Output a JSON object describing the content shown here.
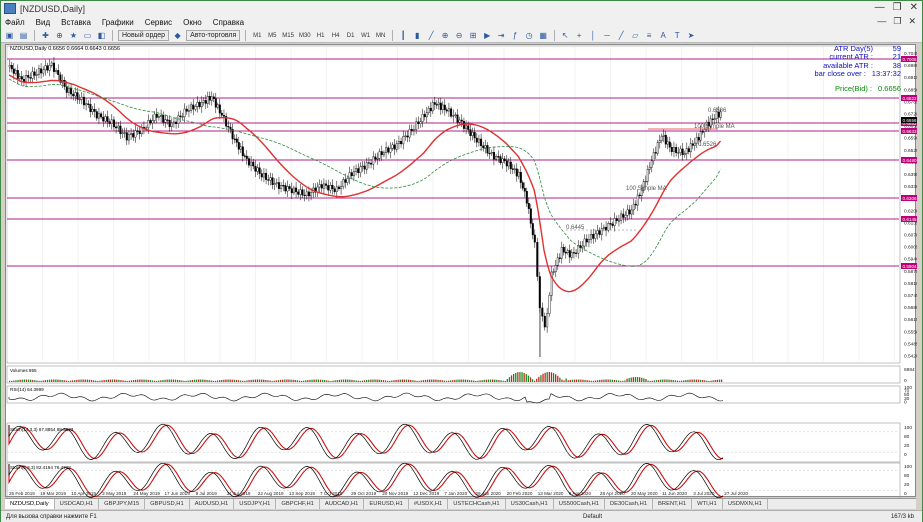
{
  "window": {
    "title": "[NZDUSD,Daily]",
    "controls": [
      "—",
      "❐",
      "✕"
    ]
  },
  "menu": {
    "items": [
      "Файл",
      "Вид",
      "Вставка",
      "Графики",
      "Сервис",
      "Окно",
      "Справка"
    ],
    "mdi_controls": [
      "—",
      "❐",
      "✕"
    ]
  },
  "toolbar": {
    "new_order_label": "Новый ордер",
    "autotrade_label": "Авто-торговля",
    "timeframes": [
      "M1",
      "M5",
      "M15",
      "M30",
      "H1",
      "H4",
      "D1",
      "W1",
      "MN"
    ]
  },
  "chart": {
    "symbol_line": "NZDUSD,Daily  0.6656 0.6664 0.6643 0.6656",
    "volume_label": "Volumes 955",
    "rsi_label": "RSI(14) 64.3999",
    "stoch1_label": "Stoch(14,3,3) 67.8854 68.9833",
    "stoch2_label": "Stoch(5,3,3) 82.4194 76.4738",
    "info": {
      "atr_day_label": "ATR Day(5)",
      "atr_day_value": "59",
      "current_atr_label": "current ATR :",
      "current_atr_value": "21",
      "available_atr_label": "available ATR :",
      "available_atr_value": "38",
      "bar_close_label": "bar close over :",
      "bar_close_value": "13:37:32",
      "price_bid_label": "Price(Bid) :",
      "price_bid_value": "0.6656"
    },
    "annotations": {
      "ma200": "100 Simple MA",
      "ma100": "100 Simple MA",
      "lvl1": "0.6686",
      "lvl2": "0.6526",
      "lvl3": "0.6445"
    },
    "colors": {
      "candle": "#000000",
      "ma_red": "#e03030",
      "ma_green": "#2e8b3e",
      "level_line": "#b0208a",
      "level_tag": "#c0007a",
      "bid_tag": "#000000",
      "stoch_main": "#000000",
      "stoch_signal": "#cc1111",
      "volume_bar": "#cc2222",
      "volume_bar_up": "#1a8a1a"
    },
    "price_labels": [
      "0.7045",
      "0.6980",
      "0.6915",
      "0.6850",
      "0.6785",
      "0.6720",
      "0.6655",
      "0.6590",
      "0.6525",
      "0.6460",
      "0.6395",
      "0.6330",
      "0.6265",
      "0.6200",
      "0.6135",
      "0.6070",
      "0.6005",
      "0.5940",
      "0.5875",
      "0.5810",
      "0.5745",
      "0.5680",
      "0.5615",
      "0.5550",
      "0.5485",
      "0.5420"
    ],
    "level_tags": [
      "0.7005",
      "0.6822",
      "0.6652",
      "0.6633",
      "0.6480",
      "0.6306",
      "0.6145",
      "0.5904"
    ],
    "bid_tag": "0.6656",
    "volume_scales": [
      "6884",
      "0"
    ],
    "rsi_scales": [
      "100",
      "70",
      "50",
      "30",
      "0"
    ],
    "stoch1_scales": [
      "100",
      "80",
      "20",
      "0"
    ],
    "stoch2_scales": [
      "100",
      "80",
      "20",
      "0"
    ],
    "date_labels": [
      "25 Feb 2019",
      "19 Mar 2019",
      "10 Apr 2019",
      "2 May 2019",
      "24 May 2019",
      "17 Jun 2019",
      "9 Jul 2019",
      "31 Jul 2019",
      "22 Aug 2019",
      "13 Sep 2019",
      "7 Oct 2019",
      "29 Oct 2019",
      "20 Nov 2019",
      "12 Dec 2019",
      "7 Jan 2020",
      "29 Jan 2020",
      "20 Feb 2020",
      "13 Mar 2020",
      "6 Apr 2020",
      "28 Apr 2020",
      "20 May 2020",
      "11 Jun 2020",
      "3 Jul 2020",
      "27 Jul 2020"
    ]
  },
  "tabs": [
    "NZDUSD,Daily",
    "USDCAD,H1",
    "GBPJPY,M15",
    "GBPUSD,H1",
    "AUDUSD,H1",
    "USDJPY,H1",
    "GBPCHF,H1",
    "AUDCAD,H1",
    "EURUSD,H1",
    "#USDX,H1",
    "USTECHCash,H1",
    "US30Cash,H1",
    "US500Cash,H1",
    "DE30Cash,H1",
    "BRENT,H1",
    "WTI,H1",
    "USDMXN,H1"
  ],
  "status": {
    "help": "Для вызова справки нажмите F1",
    "profile": "Default",
    "traffic": "167/3 kb"
  }
}
